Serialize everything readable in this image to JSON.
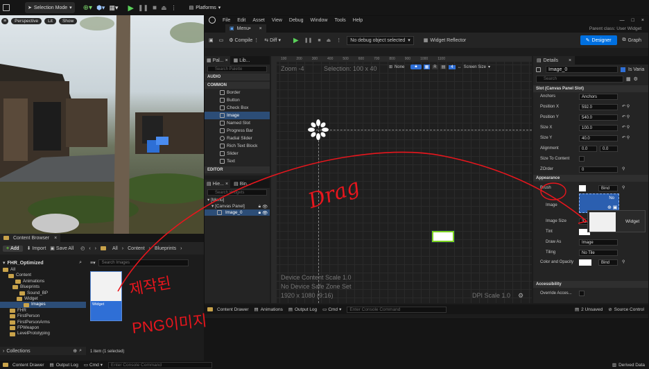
{
  "main_toolbar": {
    "selection_mode": "Selection Mode",
    "platforms": "Platforms"
  },
  "viewport": {
    "perspective": "Perspective",
    "lit": "Lit",
    "show": "Show"
  },
  "umg": {
    "tab_title": "Menu•",
    "menus": [
      "File",
      "Edit",
      "Asset",
      "View",
      "Debug",
      "Window",
      "Tools",
      "Help"
    ],
    "parent_class": "Parent class: User Widget",
    "compile": "Compile",
    "diff": "Diff",
    "debug_select": "No debug object selected",
    "widget_reflector": "Widget Reflector",
    "designer": "Designer",
    "graph": "Graph"
  },
  "palette": {
    "tab": "Pal...",
    "library_tab": "Lib...",
    "search_placeholder": "Search Palette",
    "audio": "AUDIO",
    "common": "COMMON",
    "items": [
      "Border",
      "Button",
      "Check Box",
      "Image",
      "Named Slot",
      "Progress Bar",
      "Radial Slider",
      "Rich Text Block",
      "Slider",
      "Text"
    ],
    "editor": "EDITOR"
  },
  "hierarchy": {
    "tab": "Hie...",
    "bind_tab": "Bin...",
    "search_placeholder": "Search Widgets",
    "items": [
      "[Menu]",
      "[Canvas Panel]",
      "Image_0"
    ]
  },
  "designer_canvas": {
    "ruler": [
      "100",
      "200",
      "300",
      "400",
      "500",
      "600",
      "700",
      "800",
      "900",
      "1000",
      "1100"
    ],
    "zoom": "Zoom -4",
    "selection": "Selection: 100 x 40",
    "none": "None",
    "r": "R",
    "grid_num": "4",
    "screen_size": "Screen Size",
    "device_scale": "Device Content Scale 1.0",
    "safe_zone": "No Device Safe Zone Set",
    "resolution": "1920 x 1080 (9:16)",
    "dpi": "DPI Scale 1.0"
  },
  "details": {
    "tab": "Details",
    "name_value": "Image_0",
    "is_variable": "Is Varia",
    "search_placeholder": "Search",
    "slot_header": "Slot (Canvas Panel Slot)",
    "anchors_label": "Anchors",
    "anchors_value": "Anchors",
    "position_x_label": "Position X",
    "position_x": "592.0",
    "position_y_label": "Position Y",
    "position_y": "540.0",
    "size_x_label": "Size X",
    "size_x": "100.0",
    "size_y_label": "Size Y",
    "size_y": "40.0",
    "alignment_label": "Alignment",
    "alignment_x": "0.0",
    "alignment_y": "0.0",
    "size_to_content": "Size To Content",
    "zorder_label": "ZOrder",
    "zorder": "0",
    "appearance": "Appearance",
    "brush": "Brush",
    "bind": "Bind",
    "image": "Image",
    "none": "No",
    "image_size": "Image Size",
    "image_size_val": "32.0",
    "tint": "Tint",
    "draw_as": "Draw As",
    "draw_as_value": "Image",
    "tiling": "Tiling",
    "tiling_value": "No Tile",
    "color_opacity": "Color and Opacity",
    "accessibility": "Accessibility",
    "override_access": "Override Acces...",
    "drag_tooltip": "Widget"
  },
  "bottom_umg": {
    "content_drawer": "Content Drawer",
    "animations": "Animations",
    "output_log": "Output Log",
    "cmd": "Cmd",
    "console_placeholder": "Enter Console Command",
    "unsaved": "2 Unsaved",
    "source_control": "Source Control"
  },
  "content_browser": {
    "tab": "Content Browser",
    "add": "Add",
    "import": "Import",
    "save_all": "Save All",
    "breadcrumb": [
      "All",
      "Content",
      "Blueprints"
    ],
    "project": "FHR_Optimized",
    "tree": [
      "All",
      "Content",
      "Animations",
      "Blueprints",
      "Sound_BP",
      "Widget",
      "Images",
      "FHR",
      "FirstPerson",
      "FirstPersonArms",
      "FPWeapon",
      "LevelPrototyping"
    ],
    "search_placeholder": "Search Images",
    "asset_label": "Widget",
    "collections": "Collections",
    "status": "1 item (1 selected)"
  },
  "bottom_main": {
    "content_drawer": "Content Drawer",
    "output_log": "Output Log",
    "cmd": "Cmd",
    "console_placeholder": "Enter Console Command",
    "derived_data": "Derived Data"
  },
  "annotations": {
    "drag": "Drag",
    "note_line1": "제작된",
    "note_line2": "PNG이미지"
  },
  "colors": {
    "accent": "#0070e0",
    "selection": "#2c4d77",
    "annotation_red": "#e8161d",
    "canvas_bg": "#1f1f1f"
  }
}
